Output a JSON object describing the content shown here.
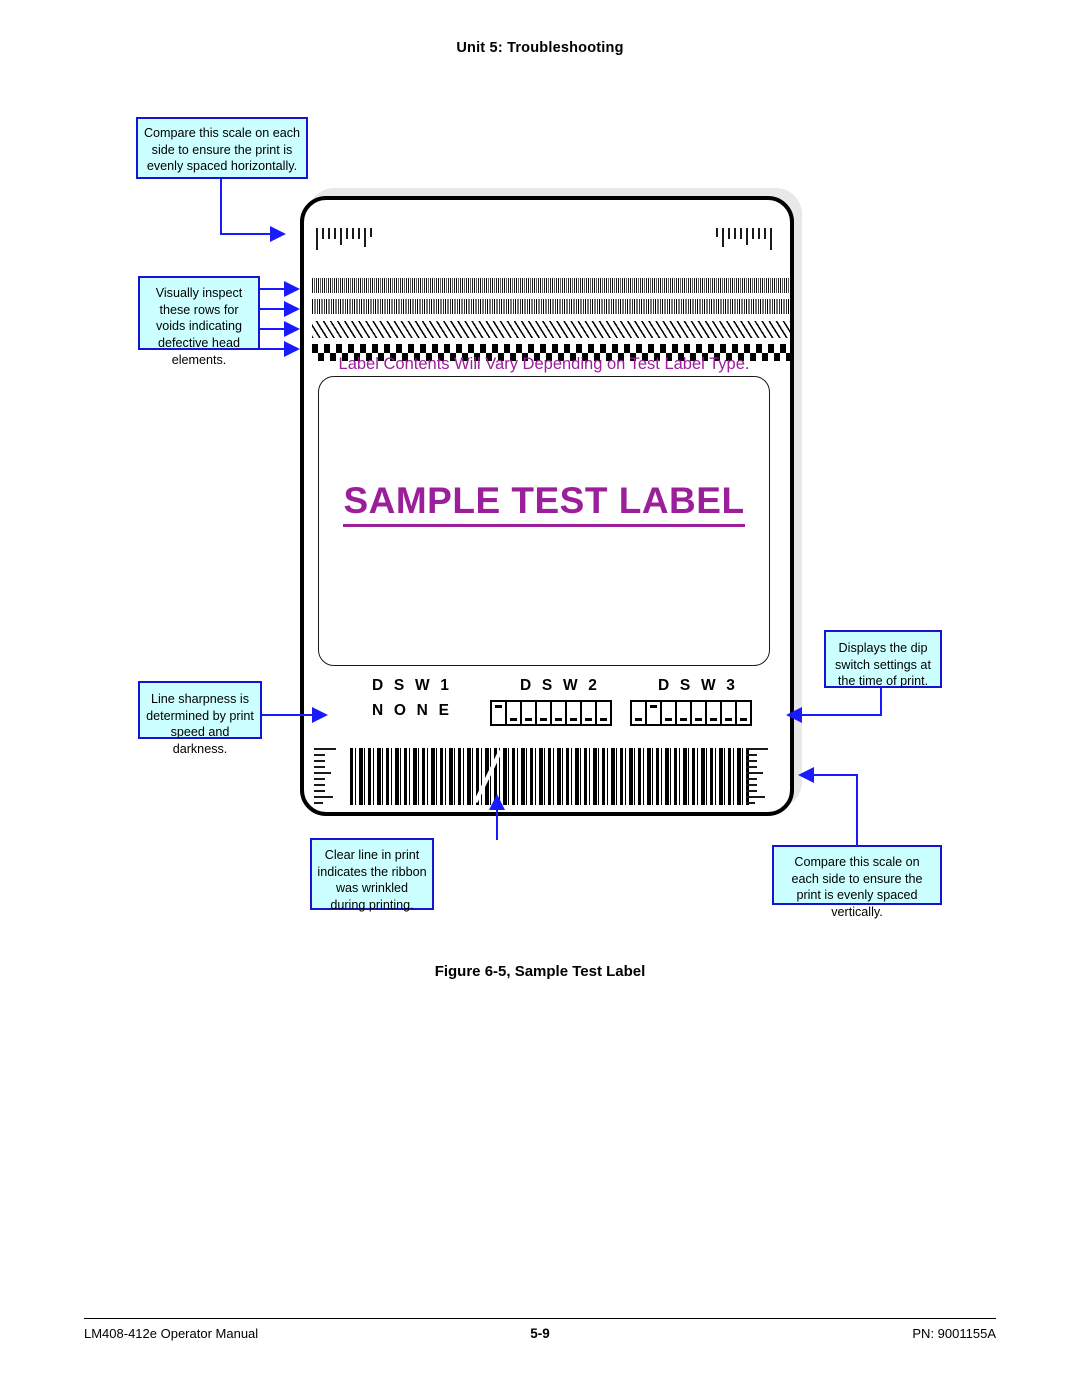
{
  "page": {
    "header": "Unit 5:  Troubleshooting",
    "figure_caption": "Figure 6-5, Sample Test Label"
  },
  "footer": {
    "manual": "LM408-412e Operator Manual",
    "page_number": "5-9",
    "part_number": "PN: 9001155A"
  },
  "callouts": {
    "horizontal_scale": "Compare this scale on each side to ensure the print is evenly spaced horizontally.",
    "void_rows": "Visually inspect these rows for voids indicating defective head elements.",
    "line_sharpness": "Line sharpness is determined by print speed and darkness.",
    "ribbon_wrinkle": "Clear line in print indicates the ribbon was wrinkled during printing.",
    "dip_switch": "Displays the dip switch settings at the time of print.",
    "vertical_scale": "Compare this scale on each side to ensure the print is evenly spaced vertically."
  },
  "label": {
    "title": "SAMPLE TEST LABEL",
    "subtitle": "Label Contents Will Vary Depending on Test Label Type.",
    "dsw": {
      "dsw1_label": "D S W 1",
      "dsw1_value": "N O N E",
      "dsw2_label": "D S W 2",
      "dsw2_switches": [
        "up",
        "down",
        "down",
        "down",
        "down",
        "down",
        "down",
        "down"
      ],
      "dsw3_label": "D S W 3",
      "dsw3_switches": [
        "down",
        "up",
        "down",
        "down",
        "down",
        "down",
        "down",
        "down"
      ]
    },
    "patterns": [
      "fine-vertical-lines-band-1",
      "fine-vertical-lines-band-2",
      "diagonal-slash-band",
      "checkerboard-band"
    ],
    "rulers": {
      "top_left": "horizontal-ruler-scale",
      "top_right": "horizontal-ruler-scale",
      "bottom_left": "vertical-ruler-scale",
      "bottom_right": "vertical-ruler-scale"
    },
    "barcode": "barcode-with-ribbon-wrinkle-void"
  },
  "colors": {
    "callout_fill": "#ccffff",
    "callout_border": "#1414d2",
    "leader_line": "#1a1aff",
    "label_text": "#9b1f9b"
  }
}
